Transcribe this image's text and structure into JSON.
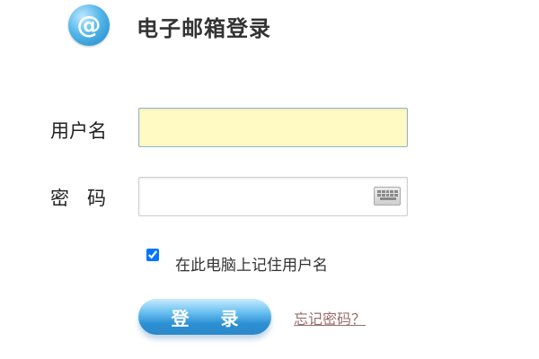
{
  "header": {
    "title": "电子邮箱登录",
    "logo_glyph": "@"
  },
  "form": {
    "username_label": "用户名",
    "password_label_1": "密",
    "password_label_2": "码",
    "username_value": "",
    "password_value": "",
    "remember_label": "在此电脑上记住用户名",
    "remember_checked": true
  },
  "actions": {
    "login_label": "登 录",
    "forgot_label": "忘记密码？"
  },
  "colors": {
    "accent": "#2b8fd3",
    "username_bg": "#fff9c4",
    "forgot_link": "#9a6c6c"
  }
}
